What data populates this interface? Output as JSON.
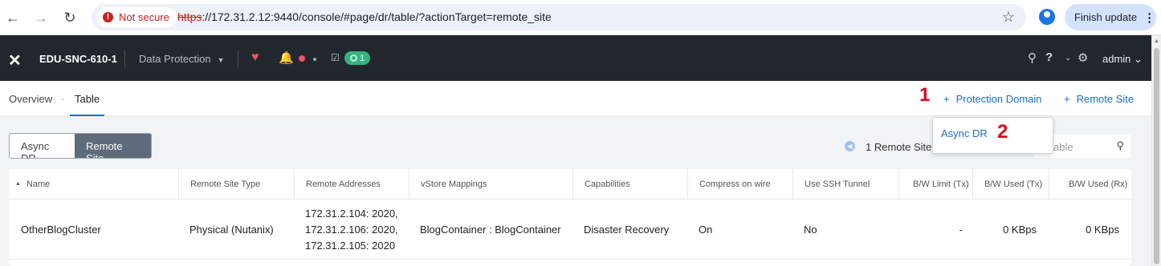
{
  "browser": {
    "security_label": "Not secure",
    "url_scheme": "https",
    "url_rest": "://172.31.2.12:9440/console/#page/dr/table/?actionTarget=remote_site",
    "finish_update_label": "Finish update",
    "icons": [
      "back-arrow-icon",
      "forward-arrow-icon",
      "reload-icon",
      "warning-icon",
      "star-icon",
      "profile-icon",
      "kebab-menu-icon"
    ]
  },
  "app": {
    "cluster_name": "EDU-SNC-610-1",
    "section": "Data Protection",
    "task_count": "1",
    "user": "admin",
    "accent_color": "#1b6dc1",
    "alert_color": "#f0506e",
    "task_color": "#36b37e"
  },
  "subnav": {
    "overview": "Overview",
    "separator": "·",
    "table": "Table",
    "protection_domain_action": "Protection Domain",
    "remote_site_action": "Remote Site",
    "plus": "+"
  },
  "annotations": {
    "marker1": "1",
    "marker2": "2",
    "marker_color": "#e3001b"
  },
  "toolbar": {
    "async_dr": "Async DR",
    "remote_site": "Remote Site",
    "count_label": "1 Remote Site",
    "filter_placeholder": "able"
  },
  "dropdown": {
    "item": "Async DR"
  },
  "table": {
    "columns": [
      "Name",
      "Remote Site Type",
      "Remote Addresses",
      "vStore Mappings",
      "Capabilities",
      "Compress on wire",
      "Use SSH Tunnel",
      "B/W Limit (Tx)",
      "B/W Used (Tx)",
      "B/W Used (Rx)"
    ],
    "rows": [
      {
        "name": "OtherBlogCluster",
        "type": "Physical (Nutanix)",
        "addresses": [
          "172.31.2.104: 2020,",
          "172.31.2.106: 2020,",
          "172.31.2.105: 2020"
        ],
        "vstore": "BlogContainer : BlogContainer",
        "capabilities": "Disaster Recovery",
        "compress": "On",
        "ssh": "No",
        "bw_limit_tx": "-",
        "bw_used_tx": "0 KBps",
        "bw_used_rx": "0 KBps"
      }
    ]
  }
}
